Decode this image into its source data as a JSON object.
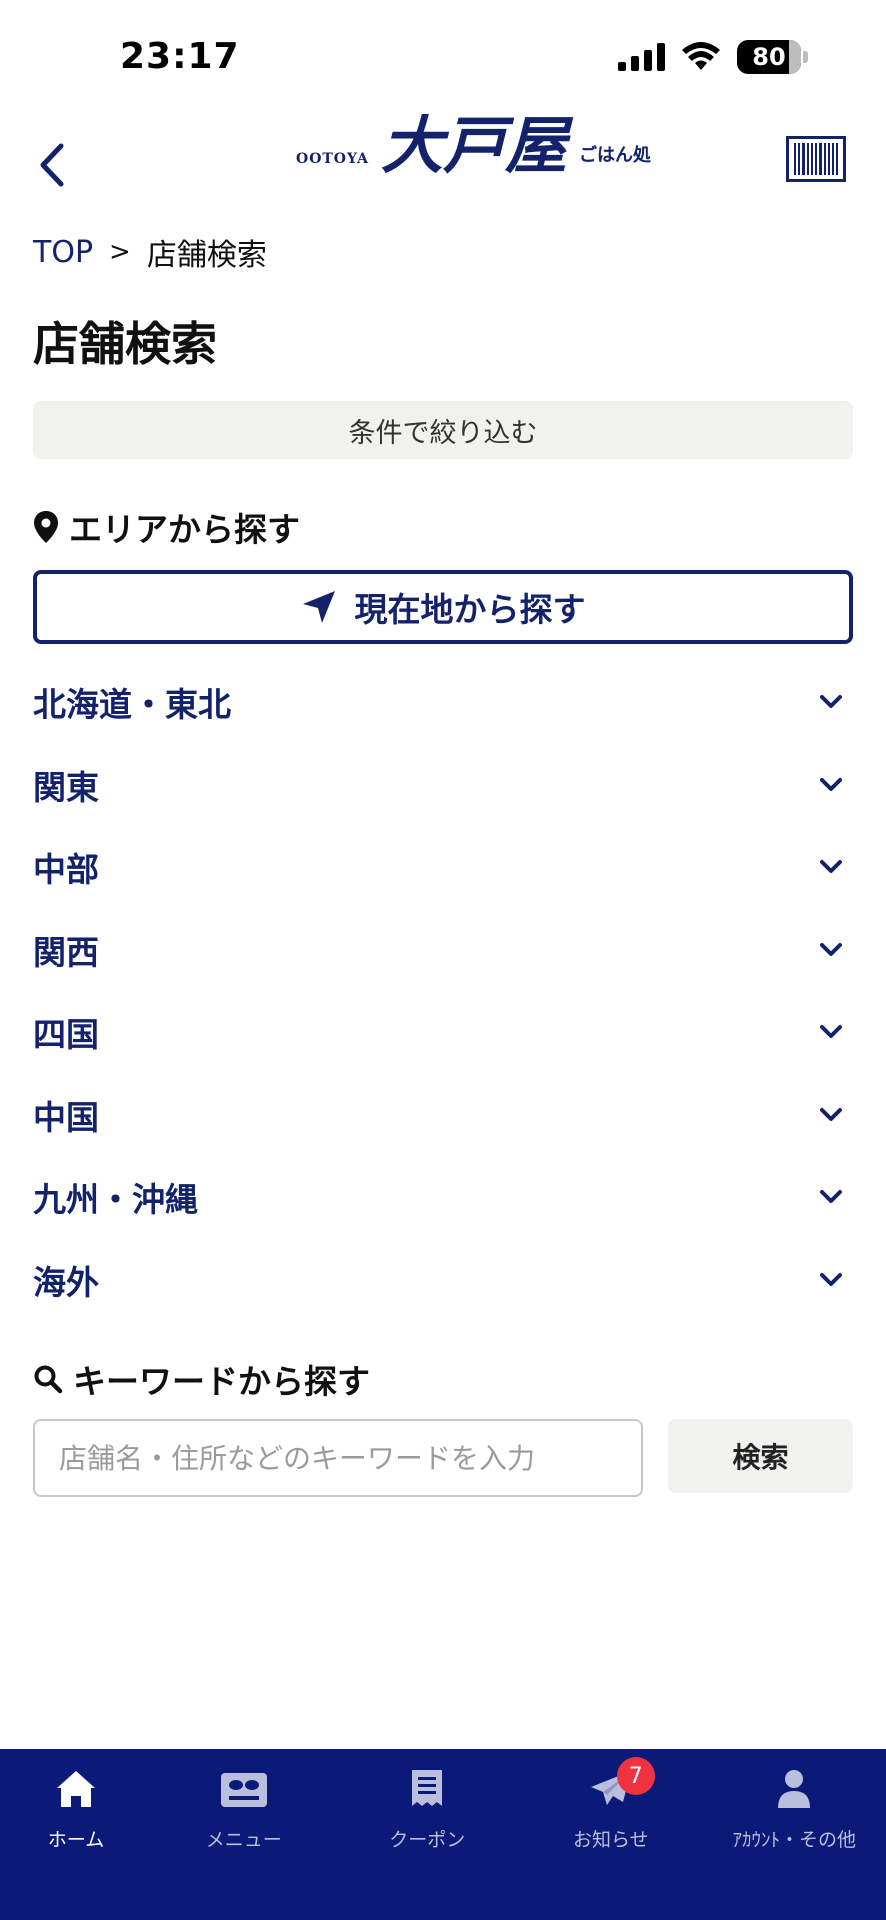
{
  "status_bar": {
    "time": "23:17",
    "battery": "80"
  },
  "header": {
    "logo": {
      "small": "OOTOYA",
      "main": "大戸屋",
      "sub": "ごはん処"
    },
    "back_icon": "chevron-left-icon",
    "barcode_icon": "barcode-icon"
  },
  "breadcrumb": {
    "top": "TOP",
    "separator": ">",
    "current": "店舗検索"
  },
  "page_title": "店舗検索",
  "filter_button": "条件で絞り込む",
  "area_section": {
    "heading": "エリアから探す",
    "icon": "map-pin-icon",
    "location_button": "現在地から探す",
    "location_icon": "navigation-arrow-icon",
    "regions": [
      {
        "label": "北海道・東北"
      },
      {
        "label": "関東"
      },
      {
        "label": "中部"
      },
      {
        "label": "関西"
      },
      {
        "label": "四国"
      },
      {
        "label": "中国"
      },
      {
        "label": "九州・沖縄"
      },
      {
        "label": "海外"
      }
    ]
  },
  "keyword_section": {
    "heading": "キーワードから探す",
    "icon": "search-icon",
    "input_placeholder": "店舗名・住所などのキーワードを入力",
    "input_value": "",
    "search_button": "検索"
  },
  "bottom_nav": {
    "items": [
      {
        "label": "ホーム",
        "icon": "home-icon",
        "active": true
      },
      {
        "label": "メニュー",
        "icon": "menu-icon",
        "active": false
      },
      {
        "label": "クーポン",
        "icon": "coupon-icon",
        "active": false
      },
      {
        "label": "お知らせ",
        "icon": "paper-plane-icon",
        "active": false,
        "badge": "7"
      },
      {
        "label": "ｱｶｳﾝﾄ・その他",
        "icon": "account-icon",
        "active": false
      }
    ]
  },
  "colors": {
    "brand_navy": "#13226b",
    "nav_background": "#0b1a78",
    "badge_red": "#ef3340",
    "button_gray": "#f1f1ef"
  }
}
